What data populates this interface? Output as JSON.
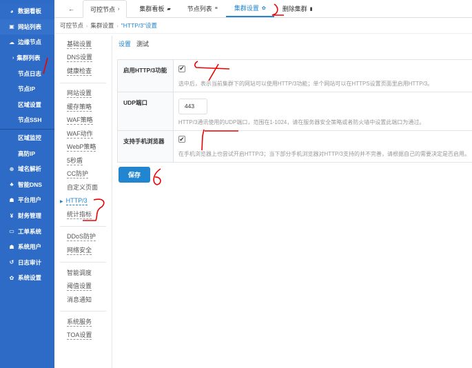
{
  "sidebar": {
    "items": [
      {
        "icon": "dashboard-icon",
        "glyph": "◕",
        "label": "数据看板"
      },
      {
        "icon": "copy-icon",
        "glyph": "▣",
        "label": "网站列表"
      },
      {
        "icon": "cloud-icon",
        "glyph": "☁",
        "label": "边缘节点"
      },
      {
        "label": "集群列表"
      },
      {
        "label": "节点日志"
      },
      {
        "label": "节点IP"
      },
      {
        "label": "区域设置"
      },
      {
        "label": "节点SSH"
      },
      {
        "label": "区域监控"
      },
      {
        "label": "高防IP"
      },
      {
        "icon": "globe-icon",
        "glyph": "⊕",
        "label": "域名解析"
      },
      {
        "icon": "cubes-icon",
        "glyph": "♣",
        "label": "智能DNS"
      },
      {
        "icon": "users-icon",
        "glyph": "☗",
        "label": "平台用户"
      },
      {
        "icon": "yen-icon",
        "glyph": "¥",
        "label": "财务管理"
      },
      {
        "icon": "ticket-icon",
        "glyph": "▭",
        "label": "工单系统"
      },
      {
        "icon": "user-icon",
        "glyph": "☗",
        "label": "系统用户"
      },
      {
        "icon": "history-icon",
        "glyph": "↺",
        "label": "日志审计"
      },
      {
        "icon": "cog-icon",
        "glyph": "✿",
        "label": "系统设置"
      }
    ]
  },
  "topbar": {
    "back": "←",
    "tabs": [
      {
        "label": "可控节点",
        "icon": "›"
      },
      {
        "label": "集群看板",
        "icon": "▰"
      },
      {
        "label": "节点列表",
        "icon": "≡"
      },
      {
        "label": "集群设置",
        "icon": "✿"
      },
      {
        "label": "删除集群",
        "icon": "▮"
      }
    ]
  },
  "breadcrumb": [
    "可控节点",
    "集群设置",
    "\"HTTP/3\"设置"
  ],
  "submenu": {
    "groups": [
      [
        "基础设置",
        "DNS设置",
        "健康检查"
      ],
      [
        "网站设置",
        "缓存策略",
        "WAF策略",
        "WAF动作",
        "WebP策略",
        "5秒盾",
        "CC防护",
        "自定义页面",
        "HTTP/3",
        "统计指标"
      ],
      [
        "DDoS防护",
        "网络安全"
      ],
      [
        "智能调度",
        "阈值设置",
        "消息通知"
      ],
      [
        "系统服务",
        "TOA设置"
      ]
    ]
  },
  "subtabs": [
    "设置",
    "测试"
  ],
  "settings": {
    "http3": {
      "label": "启用HTTP/3功能",
      "checked": true,
      "comment": "选中后，表示当前集群下的网站可以使用HTTP/3功能；单个网站可以在HTTPS设置页面里启用HTTP/3。"
    },
    "udp": {
      "label": "UDP端口",
      "value": "443",
      "comment": "HTTP/3通讯使用的UDP端口，范围在1-1024，请在服务器安全策略或者防火墙中设置此端口为通过。"
    },
    "mobile": {
      "label": "支持手机浏览器",
      "checked": true,
      "comment": "在手机浏览器上也尝试开启HTTP/3；当下部分手机浏览器对HTTP/3支持的并不完善，请根据自己的需要决定是否启用。"
    }
  },
  "save_label": "保存",
  "check_glyph": "✔",
  "colors": {
    "sidebar": "#2d6bc6",
    "accent": "#2185d0"
  }
}
